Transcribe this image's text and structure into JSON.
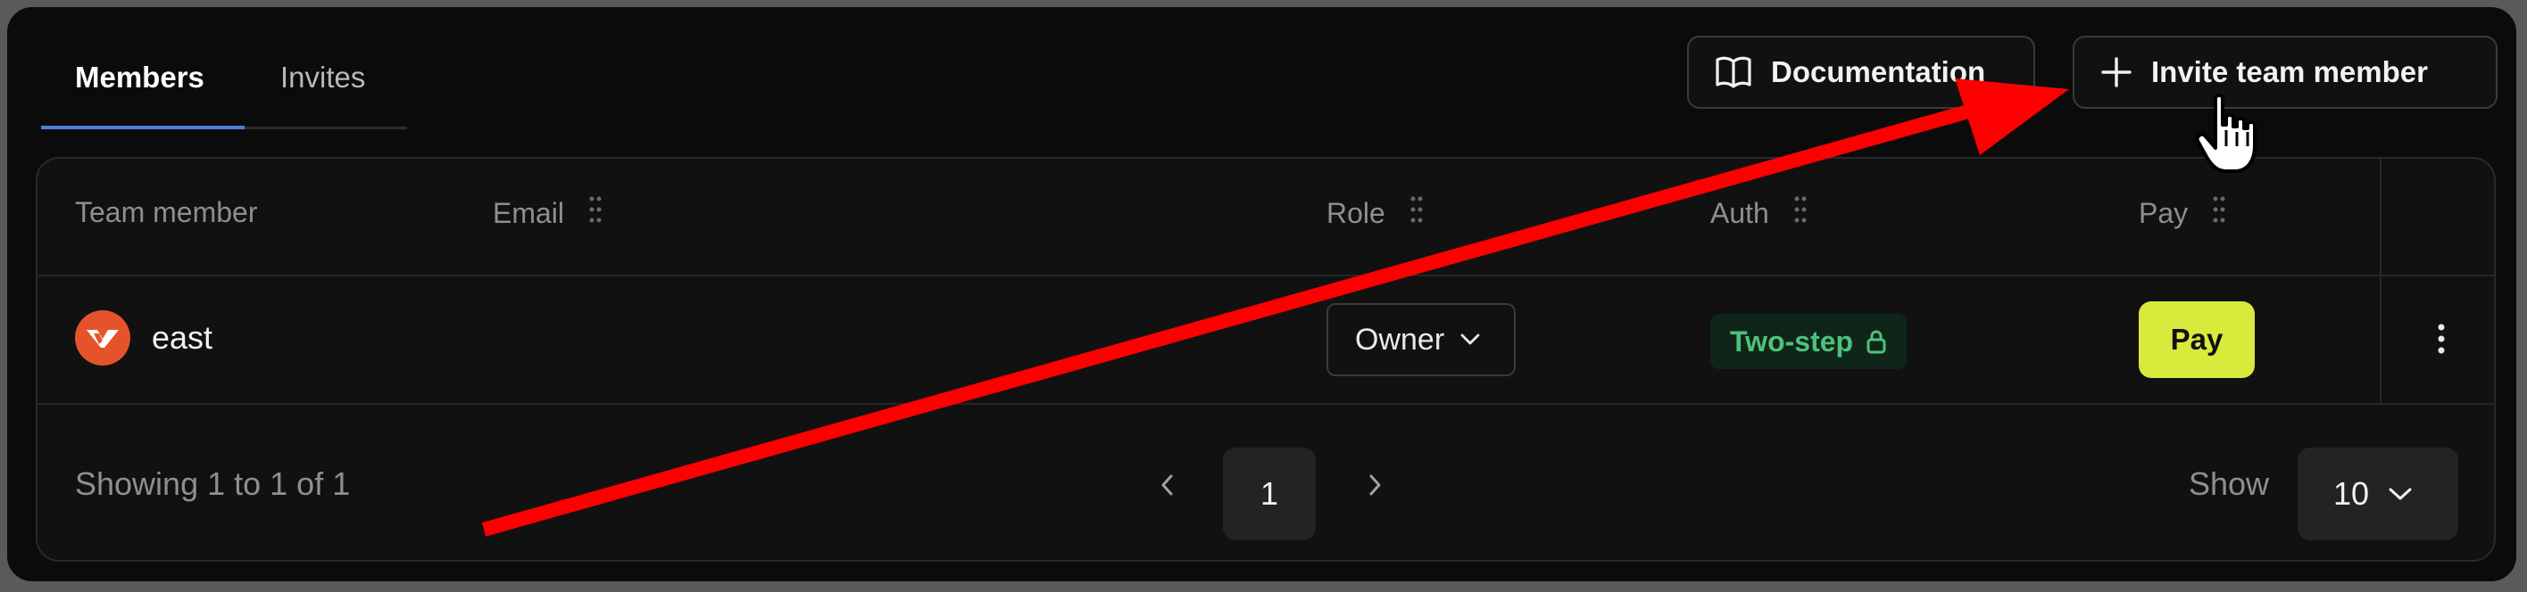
{
  "tabs": [
    {
      "label": "Members",
      "active": true
    },
    {
      "label": "Invites",
      "active": false
    }
  ],
  "toolbar": {
    "docs_label": "Documentation",
    "docs_icon": "book-open-icon",
    "invite_label": "Invite team member",
    "invite_icon": "plus-icon"
  },
  "table": {
    "headers": [
      "Team member",
      "Email",
      "Role",
      "Auth",
      "Pay"
    ],
    "rows": [
      {
        "name": "east",
        "email": "",
        "role": "Owner",
        "auth": "Two-step",
        "pay": "Pay"
      }
    ]
  },
  "pagination": {
    "showing": "Showing 1 to 1 of 1",
    "current_page": "1",
    "show_label": "Show",
    "page_size": "10"
  },
  "colors": {
    "accent": "#4d7fd6",
    "avatar": "#e5532b",
    "pay_button": "#d8ea3c",
    "auth_badge_text": "#4cc27a",
    "annotation_arrow": "#ff0000"
  }
}
